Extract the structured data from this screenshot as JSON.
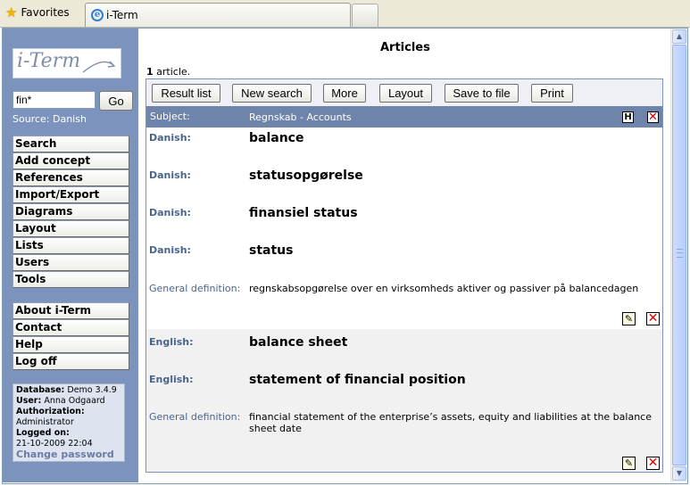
{
  "browser": {
    "favorites_label": "Favorites",
    "tab_title": "i-Term",
    "favorites_icon": "star-icon",
    "tab_icon": "ie-icon"
  },
  "sidebar": {
    "logo_text": "i-Term",
    "search_value": "fin*",
    "go_label": "Go",
    "source_text": "Source: Danish",
    "nav": [
      "Search",
      "Add concept",
      "References",
      "Import/Export",
      "Diagrams",
      "Layout",
      "Lists",
      "Users",
      "Tools"
    ],
    "nav2": [
      "About i-Term",
      "Contact",
      "Help",
      "Log off"
    ],
    "info": {
      "database_label": "Database:",
      "database_value": "Demo 3.4.9",
      "user_label": "User:",
      "user_value": "Anna Odgaard",
      "authorization_label": "Authorization:",
      "authorization_value": "Administrator",
      "logged_on_label": "Logged on:",
      "logged_on_value": "21-10-2009 22:04",
      "change_password": "Change password"
    },
    "background_color": "#7b93bd"
  },
  "main": {
    "title": "Articles",
    "count_number": "1",
    "count_suffix": "article.",
    "toolbar": [
      "Result list",
      "New search",
      "More",
      "Layout",
      "Save to file",
      "Print"
    ],
    "subject": {
      "label": "Subject:",
      "value": "Regnskab - Accounts",
      "h_icon_label": "H",
      "bar_color": "#6f84aa"
    },
    "danish": {
      "entries": [
        {
          "lang": "Danish:",
          "term": "balance"
        },
        {
          "lang": "Danish:",
          "term": "statusopgørelse"
        },
        {
          "lang": "Danish:",
          "term": "finansiel status"
        },
        {
          "lang": "Danish:",
          "term": "status"
        }
      ],
      "definition_label": "General definition:",
      "definition": "regnskabsopgørelse over en virksomheds aktiver og passiver på balancedagen"
    },
    "english": {
      "entries": [
        {
          "lang": "English:",
          "term": "balance sheet"
        },
        {
          "lang": "English:",
          "term": "statement of financial position"
        }
      ],
      "definition_label": "General definition:",
      "definition": "financial statement of the enterprise’s assets, equity and liabilities at the balance sheet date"
    },
    "icons": {
      "edit": "pencil-icon",
      "delete": "delete-x-icon",
      "delete_color": "#e00000"
    }
  }
}
